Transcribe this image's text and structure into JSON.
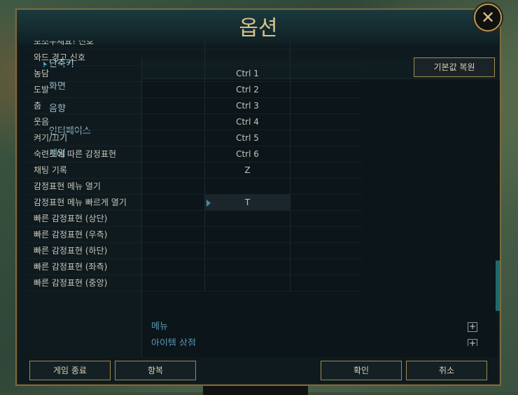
{
  "window": {
    "title": "옵션",
    "close": "✕"
  },
  "sidebar": {
    "items": [
      {
        "label": "단축키",
        "active": true
      },
      {
        "label": "화면"
      },
      {
        "label": "음향"
      },
      {
        "label": "인터페이스"
      },
      {
        "label": "게임"
      }
    ]
  },
  "panel": {
    "reset_label": "기본값 복원",
    "rows": [
      {
        "action": "보조우세요! 신호",
        "key1": "",
        "key2": ""
      },
      {
        "action": "와드 경고 신호",
        "key1": "",
        "key2": ""
      },
      {
        "action": "농담",
        "key1": "Ctrl 1",
        "key2": ""
      },
      {
        "action": "도발",
        "key1": "Ctrl 2",
        "key2": ""
      },
      {
        "action": "춤",
        "key1": "Ctrl 3",
        "key2": ""
      },
      {
        "action": "웃음",
        "key1": "Ctrl 4",
        "key2": ""
      },
      {
        "action": "켜기/끄기",
        "key1": "Ctrl 5",
        "key2": ""
      },
      {
        "action": "숙련도에 따른 감정표현",
        "key1": "Ctrl 6",
        "key2": ""
      },
      {
        "action": "채팅 기록",
        "key1": "Z",
        "key2": ""
      },
      {
        "action": "감정표현 메뉴 열기",
        "key1": "",
        "key2": ""
      },
      {
        "action": "감정표현 메뉴 빠르게 열기",
        "key1": "T",
        "key2": ""
      },
      {
        "action": "빠른 감정표현 (상단)",
        "key1": "",
        "key2": ""
      },
      {
        "action": "빠른 감정표현 (우측)",
        "key1": "",
        "key2": ""
      },
      {
        "action": "빠른 감정표현 (하단)",
        "key1": "",
        "key2": ""
      },
      {
        "action": "빠른 감정표현 (좌측)",
        "key1": "",
        "key2": ""
      },
      {
        "action": "빠른 감정표현 (중앙)",
        "key1": "",
        "key2": ""
      }
    ],
    "sections": [
      {
        "label": "메뉴"
      },
      {
        "label": "아이템 상점"
      }
    ]
  },
  "footer": {
    "exit_game": "게임 종료",
    "surrender": "항복",
    "ok": "확인",
    "cancel": "취소"
  }
}
